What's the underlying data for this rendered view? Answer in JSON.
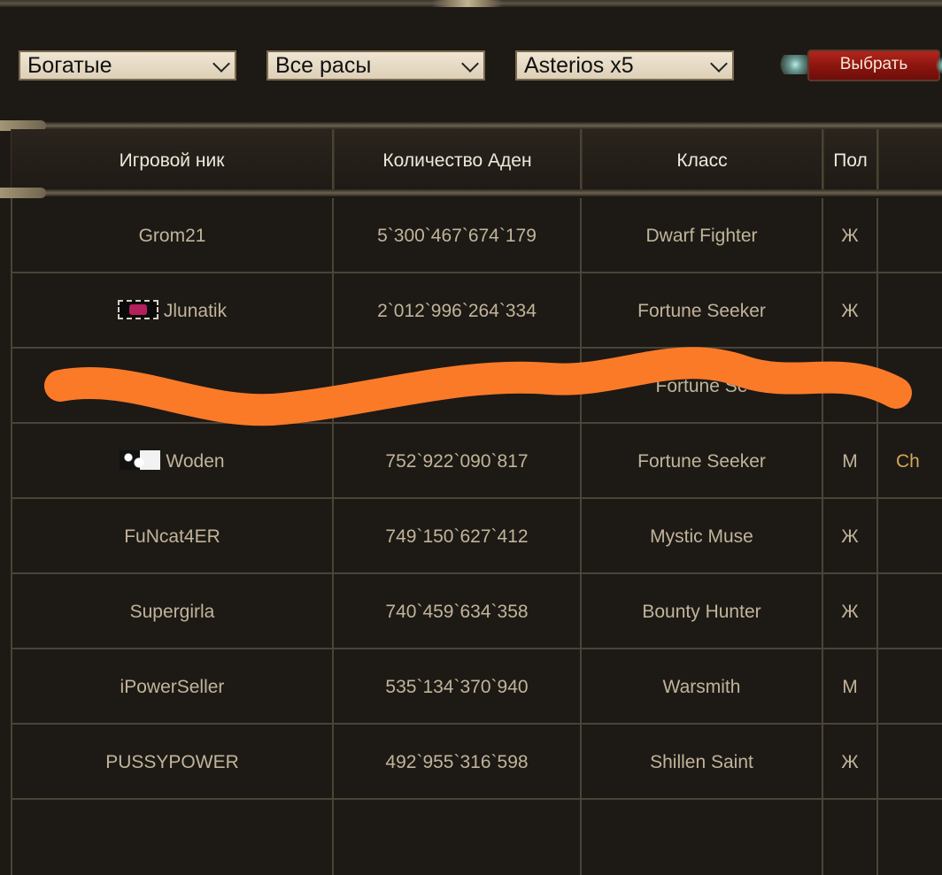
{
  "filters": {
    "category": "Богатые",
    "race": "Все расы",
    "server": "Asterios x5",
    "submit_label": "Выбрать"
  },
  "table": {
    "headers": [
      "Игровой ник",
      "Количество Аден",
      "Класс",
      "Пол"
    ],
    "rows": [
      {
        "nick": "Grom21",
        "adena": "5`300`467`674`179",
        "class": "Dwarf Fighter",
        "gender": "Ж",
        "extra": ""
      },
      {
        "nick": "Jlunatik",
        "adena": "2`012`996`264`334",
        "class": "Fortune Seeker",
        "gender": "Ж",
        "extra": ""
      },
      {
        "nick": "",
        "adena": "",
        "class": "Fortune Se",
        "gender": "",
        "extra": ""
      },
      {
        "nick": "Woden",
        "adena": "752`922`090`817",
        "class": "Fortune Seeker",
        "gender": "М",
        "extra": "Ch"
      },
      {
        "nick": "FuNcat4ER",
        "adena": "749`150`627`412",
        "class": "Mystic Muse",
        "gender": "Ж",
        "extra": ""
      },
      {
        "nick": "Supergirla",
        "adena": "740`459`634`358",
        "class": "Bounty Hunter",
        "gender": "Ж",
        "extra": ""
      },
      {
        "nick": "iPowerSeller",
        "adena": "535`134`370`940",
        "class": "Warsmith",
        "gender": "М",
        "extra": ""
      },
      {
        "nick": "PUSSYPOWER",
        "adena": "492`955`316`598",
        "class": "Shillen Saint",
        "gender": "Ж",
        "extra": ""
      }
    ]
  },
  "colors": {
    "background": "#1d1915",
    "cell_text": "#c0b49a",
    "header_text": "#efe9dc",
    "button": "#9a1a13",
    "scribble": "#fa7a28"
  }
}
